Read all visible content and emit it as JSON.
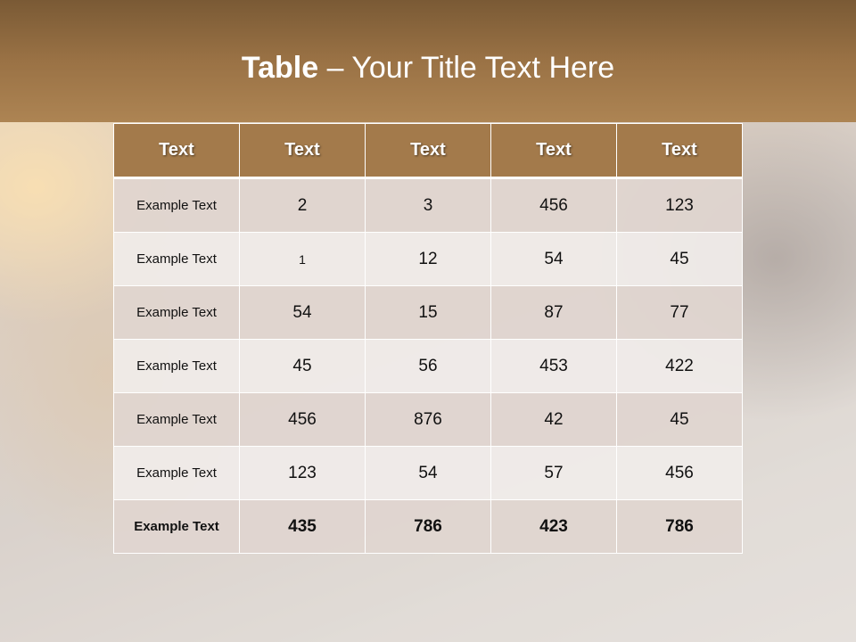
{
  "slide": {
    "title_bold": "Table",
    "title_rest": " – Your Title Text Here"
  },
  "table": {
    "headers": [
      "Text",
      "Text",
      "Text",
      "Text",
      "Text"
    ],
    "rows": [
      [
        "Example Text",
        "2",
        "3",
        "456",
        "123"
      ],
      [
        "Example Text",
        "1",
        "12",
        "54",
        "45"
      ],
      [
        "Example Text",
        "54",
        "15",
        "87",
        "77"
      ],
      [
        "Example Text",
        "45",
        "56",
        "453",
        "422"
      ],
      [
        "Example Text",
        "456",
        "876",
        "42",
        "45"
      ],
      [
        "Example Text",
        "123",
        "54",
        "57",
        "456"
      ],
      [
        "Example Text",
        "435",
        "786",
        "423",
        "786"
      ]
    ]
  },
  "colors": {
    "header_band": "#9a7245",
    "table_header": "#a37a4b",
    "row_odd": "#e0d5d0",
    "row_even": "#f0ece9"
  }
}
